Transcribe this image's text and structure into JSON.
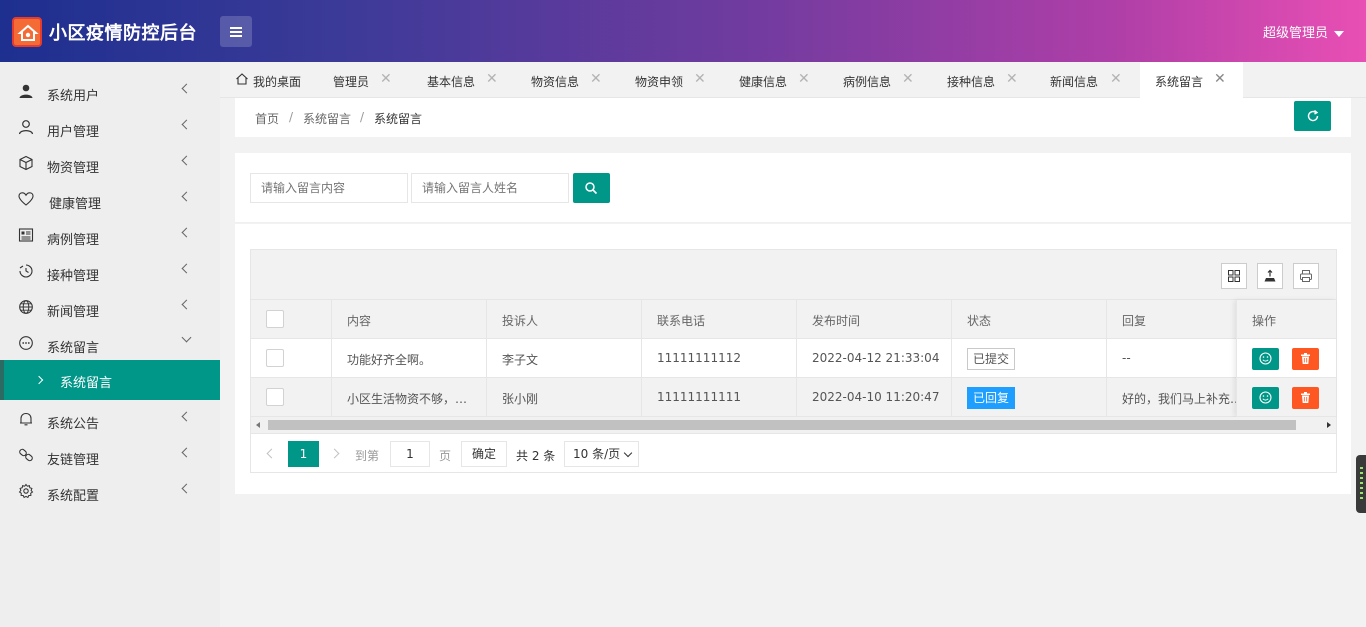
{
  "app": {
    "title": "小区疫情防控后台",
    "user": "超级管理员"
  },
  "colors": {
    "primary": "#009688",
    "danger": "#ff5722",
    "info": "#1e9fff"
  },
  "sidebar": {
    "items": [
      {
        "label": "系统用户",
        "icon": "user-icon"
      },
      {
        "label": "用户管理",
        "icon": "user-outline-icon"
      },
      {
        "label": "物资管理",
        "icon": "cube-icon"
      },
      {
        "label": "健康管理",
        "icon": "heart-icon"
      },
      {
        "label": "病例管理",
        "icon": "list-icon"
      },
      {
        "label": "接种管理",
        "icon": "vaccine-icon"
      },
      {
        "label": "新闻管理",
        "icon": "globe-icon"
      },
      {
        "label": "系统留言",
        "icon": "chat-icon"
      },
      {
        "label": "系统公告",
        "icon": "bell-icon"
      },
      {
        "label": "友链管理",
        "icon": "link-icon"
      },
      {
        "label": "系统配置",
        "icon": "gear-icon"
      }
    ],
    "submenu_active": "系统留言"
  },
  "tabs": [
    {
      "label": "我的桌面"
    },
    {
      "label": "管理员"
    },
    {
      "label": "基本信息"
    },
    {
      "label": "物资信息"
    },
    {
      "label": "物资申领"
    },
    {
      "label": "健康信息"
    },
    {
      "label": "病例信息"
    },
    {
      "label": "接种信息"
    },
    {
      "label": "新闻信息"
    },
    {
      "label": "系统留言"
    }
  ],
  "breadcrumb": [
    "首页",
    "系统留言",
    "系统留言"
  ],
  "breadcrumb_sep": "/",
  "search": {
    "content_placeholder": "请输入留言内容",
    "name_placeholder": "请输入留言人姓名"
  },
  "table": {
    "columns": [
      "内容",
      "投诉人",
      "联系电话",
      "发布时间",
      "状态",
      "回复",
      "操作"
    ],
    "rows": [
      {
        "content": "功能好齐全啊。",
        "complainant": "李子文",
        "phone": "11111111112",
        "time": "2022-04-12 21:33:04",
        "status": "已提交",
        "reply": "--"
      },
      {
        "content": "小区生活物资不够，…",
        "complainant": "张小刚",
        "phone": "11111111111",
        "time": "2022-04-10 11:20:47",
        "status": "已回复",
        "reply": "好的，我们马上补充…"
      }
    ]
  },
  "pagination": {
    "current": "1",
    "goto_label": "到第",
    "page_input": "1",
    "page_unit": "页",
    "confirm": "确定",
    "total": "共 2 条",
    "page_size": "10 条/页"
  }
}
